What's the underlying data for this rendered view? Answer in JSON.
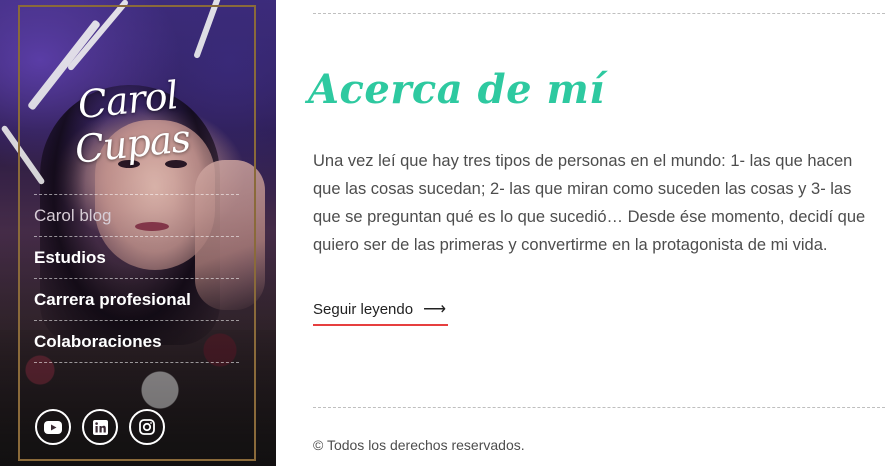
{
  "sidebar": {
    "logo_text": "Carol Cupas",
    "nav": [
      {
        "label": "Carol blog",
        "active": true
      },
      {
        "label": "Estudios",
        "active": false
      },
      {
        "label": "Carrera profesional",
        "active": false
      },
      {
        "label": "Colaboraciones",
        "active": false
      }
    ],
    "social": [
      {
        "icon": "youtube-icon"
      },
      {
        "icon": "linkedin-icon"
      },
      {
        "icon": "instagram-icon"
      }
    ]
  },
  "main": {
    "title": "Acerca de mí",
    "body": "Una vez leí que hay tres tipos de personas en el mundo: 1- las que hacen que las cosas sucedan; 2- las que miran como suceden las cosas y 3- las que se preguntan qué es lo que sucedió… Desde ése momento, decidí que quiero ser de las primeras y convertirme en la protagonista de mi vida.",
    "read_more_label": "Seguir leyendo",
    "read_more_arrow": "⟶"
  },
  "footer": {
    "copyright": "© Todos los derechos reservados."
  },
  "colors": {
    "title": "#2ec9a0",
    "link_underline": "#e63f3f",
    "frame": "#8a6a3a",
    "text": "#4d4d4d"
  }
}
